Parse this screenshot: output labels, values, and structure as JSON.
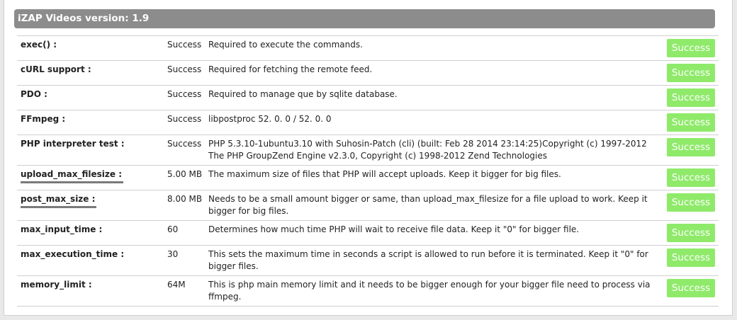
{
  "header": {
    "title": "iZAP Videos version: 1.9"
  },
  "rows": [
    {
      "name": "exec() :",
      "value": "Success",
      "description": "Required to execute the commands.",
      "status": "Success"
    },
    {
      "name": "cURL support :",
      "value": "Success",
      "description": "Required for fetching the remote feed.",
      "status": "Success"
    },
    {
      "name": "PDO :",
      "value": "Success",
      "description": "Required to manage que by sqlite database.",
      "status": "Success"
    },
    {
      "name": "FFmpeg :",
      "value": "Success",
      "description": "libpostproc 52. 0. 0 / 52. 0. 0",
      "status": "Success"
    },
    {
      "name": "PHP interpreter test :",
      "value": "Success",
      "description": "PHP 5.3.10-1ubuntu3.10 with Suhosin-Patch (cli) (built: Feb 28 2014 23:14:25)Copyright (c) 1997-2012 The PHP GroupZend Engine v2.3.0, Copyright (c) 1998-2012 Zend Technologies",
      "status": "Success"
    },
    {
      "name": "upload_max_filesize :",
      "value": "5.00 MB",
      "description": "The maximum size of files that PHP will accept uploads. Keep it bigger for big files.",
      "status": "Success"
    },
    {
      "name": "post_max_size :",
      "value": "8.00 MB",
      "description": "Needs to be a small amount bigger or same, than upload_max_filesize for a file upload to work. Keep it bigger for big files.",
      "status": "Success"
    },
    {
      "name": "max_input_time :",
      "value": "60",
      "description": "Determines how much time PHP will wait to receive file data. Keep it \"0\" for bigger file.",
      "status": "Success"
    },
    {
      "name": "max_execution_time :",
      "value": "30",
      "description": "This sets the maximum time in seconds a script is allowed to run before it is terminated. Keep it \"0\" for bigger files.",
      "status": "Success"
    },
    {
      "name": "memory_limit :",
      "value": "64M",
      "description": "This is php main memory limit and it needs to be bigger enough for your bigger file need to process via ffmpeg.",
      "status": "Success"
    }
  ],
  "colors": {
    "title_bar": "#8c8c8c",
    "success_badge": "#8fea6a"
  }
}
